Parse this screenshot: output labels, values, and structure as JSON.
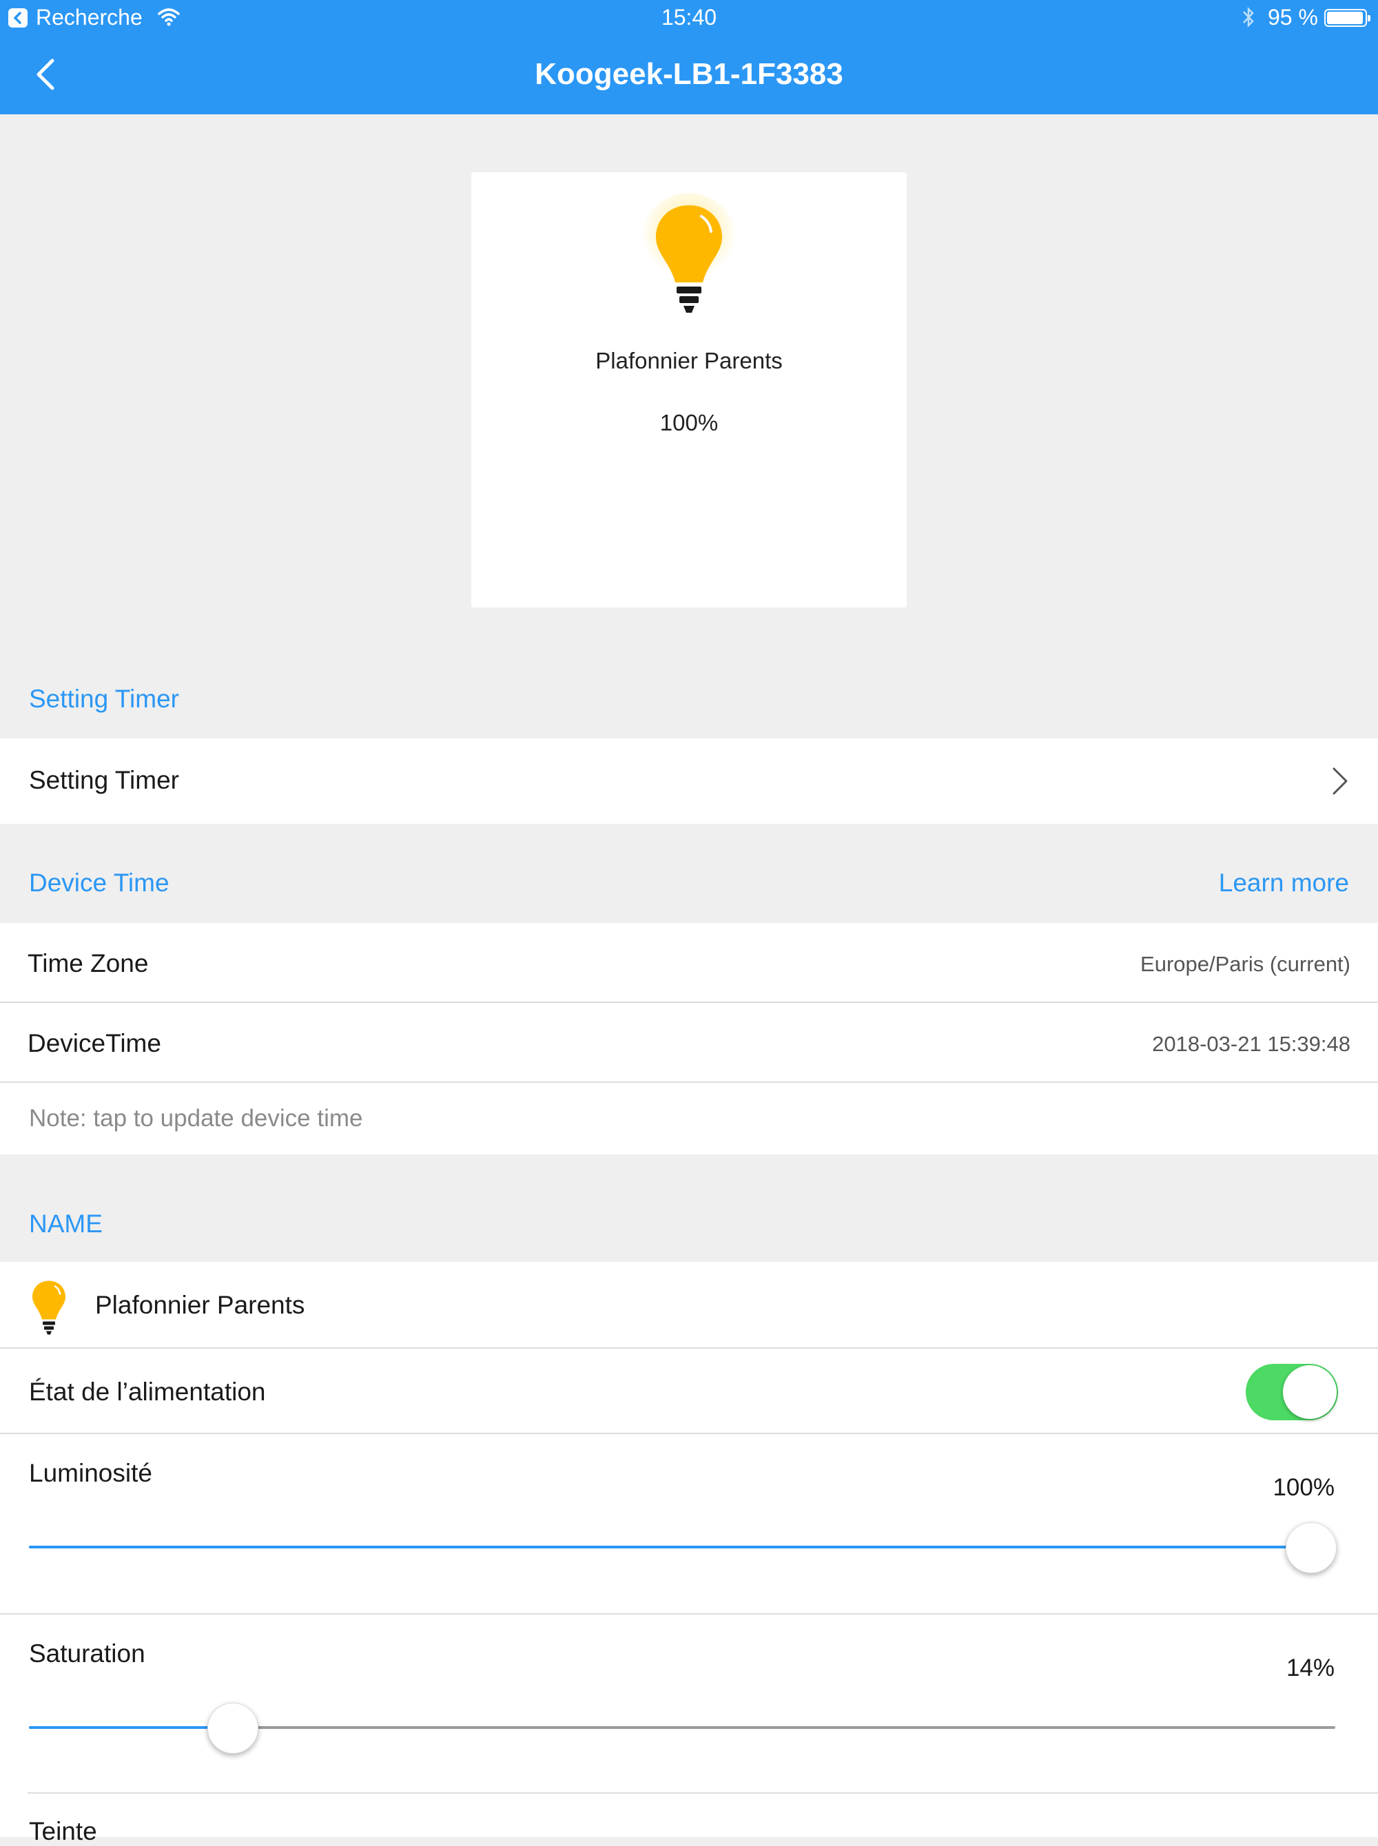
{
  "status_bar": {
    "back_app": "Recherche",
    "time": "15:40",
    "battery": "95 %"
  },
  "nav": {
    "title": "Koogeek-LB1-1F3383",
    "back_icon": "chevron-left-icon"
  },
  "device_card": {
    "icon": "bulb-icon",
    "name": "Plafonnier Parents",
    "level": "100%"
  },
  "timer_section": {
    "header": "Setting Timer",
    "row_label": "Setting Timer"
  },
  "device_time_section": {
    "header": "Device Time",
    "learn_more": "Learn more",
    "time_zone_label": "Time Zone",
    "time_zone_value": "Europe/Paris (current)",
    "device_time_label": "DeviceTime",
    "device_time_value": "2018-03-21 15:39:48",
    "note": "Note: tap to update device time"
  },
  "name_section": {
    "header": "NAME",
    "device_name": "Plafonnier Parents",
    "power_label": "État de l’alimentation",
    "power_on": true,
    "brightness_label": "Luminosité",
    "brightness_value": "100%",
    "brightness_fraction": 1.0,
    "saturation_label": "Saturation",
    "saturation_value": "14%",
    "saturation_fraction": 0.14,
    "hue_label": "Teinte"
  },
  "colors": {
    "accent": "#2b97f5",
    "toggle_on": "#4cd964",
    "bulb": "#ffb800"
  }
}
